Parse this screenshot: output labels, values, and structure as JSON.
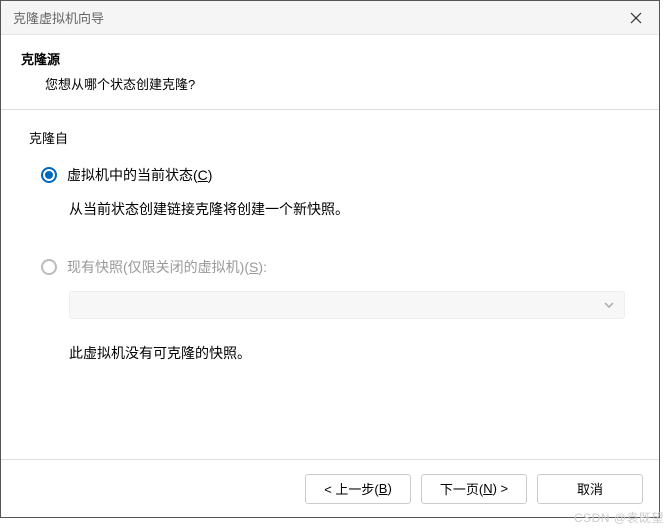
{
  "titlebar": {
    "title": "克隆虚拟机向导"
  },
  "header": {
    "title": "克隆源",
    "subtitle": "您想从哪个状态创建克隆?"
  },
  "group": {
    "label": "克隆自"
  },
  "option_current": {
    "label_pre": "虚拟机中的当前状态(",
    "label_key": "C",
    "label_post": ")",
    "hint": "从当前状态创建链接克隆将创建一个新快照。"
  },
  "option_snapshot": {
    "label_pre": "现有快照(仅限关闭的虚拟机)(",
    "label_key": "S",
    "label_post": "):",
    "hint": "此虚拟机没有可克隆的快照。"
  },
  "footer": {
    "back_pre": "< 上一步(",
    "back_key": "B",
    "back_post": ")",
    "next_pre": "下一页(",
    "next_key": "N",
    "next_post": ") >",
    "cancel": "取消"
  },
  "watermark": "CSDN @袁既望"
}
